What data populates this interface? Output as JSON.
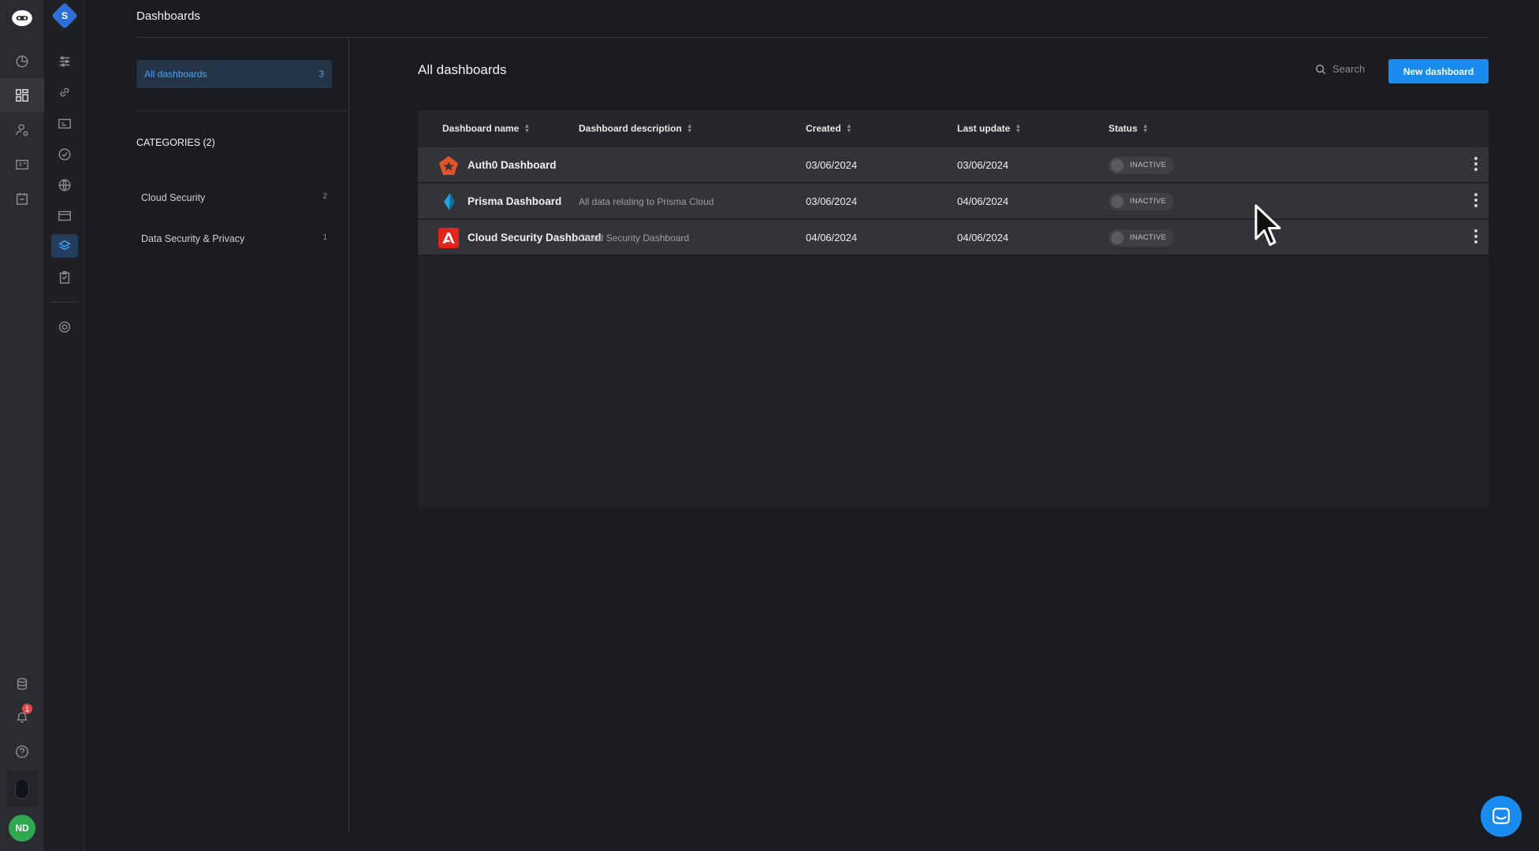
{
  "header": {
    "title": "Dashboards"
  },
  "sidebar": {
    "all_item": {
      "label": "All dashboards",
      "count": "3"
    },
    "categories_title": "CATEGORIES (2)",
    "categories": [
      {
        "label": "Cloud Security",
        "count": "2"
      },
      {
        "label": "Data Security & Privacy",
        "count": "1"
      }
    ]
  },
  "main": {
    "title": "All dashboards",
    "search_label": "Search",
    "new_button": "New dashboard"
  },
  "table": {
    "columns": [
      "Dashboard name",
      "Dashboard description",
      "Created",
      "Last update",
      "Status"
    ],
    "rows": [
      {
        "name": "Auth0 Dashboard",
        "description": "",
        "created": "03/06/2024",
        "updated": "03/06/2024",
        "status": "INACTIVE",
        "logo": "auth0-logo"
      },
      {
        "name": "Prisma Dashboard",
        "description": "All data relating to Prisma Cloud",
        "created": "03/06/2024",
        "updated": "04/06/2024",
        "status": "INACTIVE",
        "logo": "prisma-logo"
      },
      {
        "name": "Cloud Security Dashboard",
        "description": "Cloud Security Dashboard",
        "created": "04/06/2024",
        "updated": "04/06/2024",
        "status": "INACTIVE",
        "logo": "adobe-logo"
      }
    ]
  },
  "user": {
    "initials": "ND"
  },
  "notifications": {
    "count": "1"
  },
  "workspace": {
    "initial": "S"
  },
  "colors": {
    "accent": "#1a8cf0",
    "avatar": "#2fa84f",
    "badge": "#e5484d"
  }
}
